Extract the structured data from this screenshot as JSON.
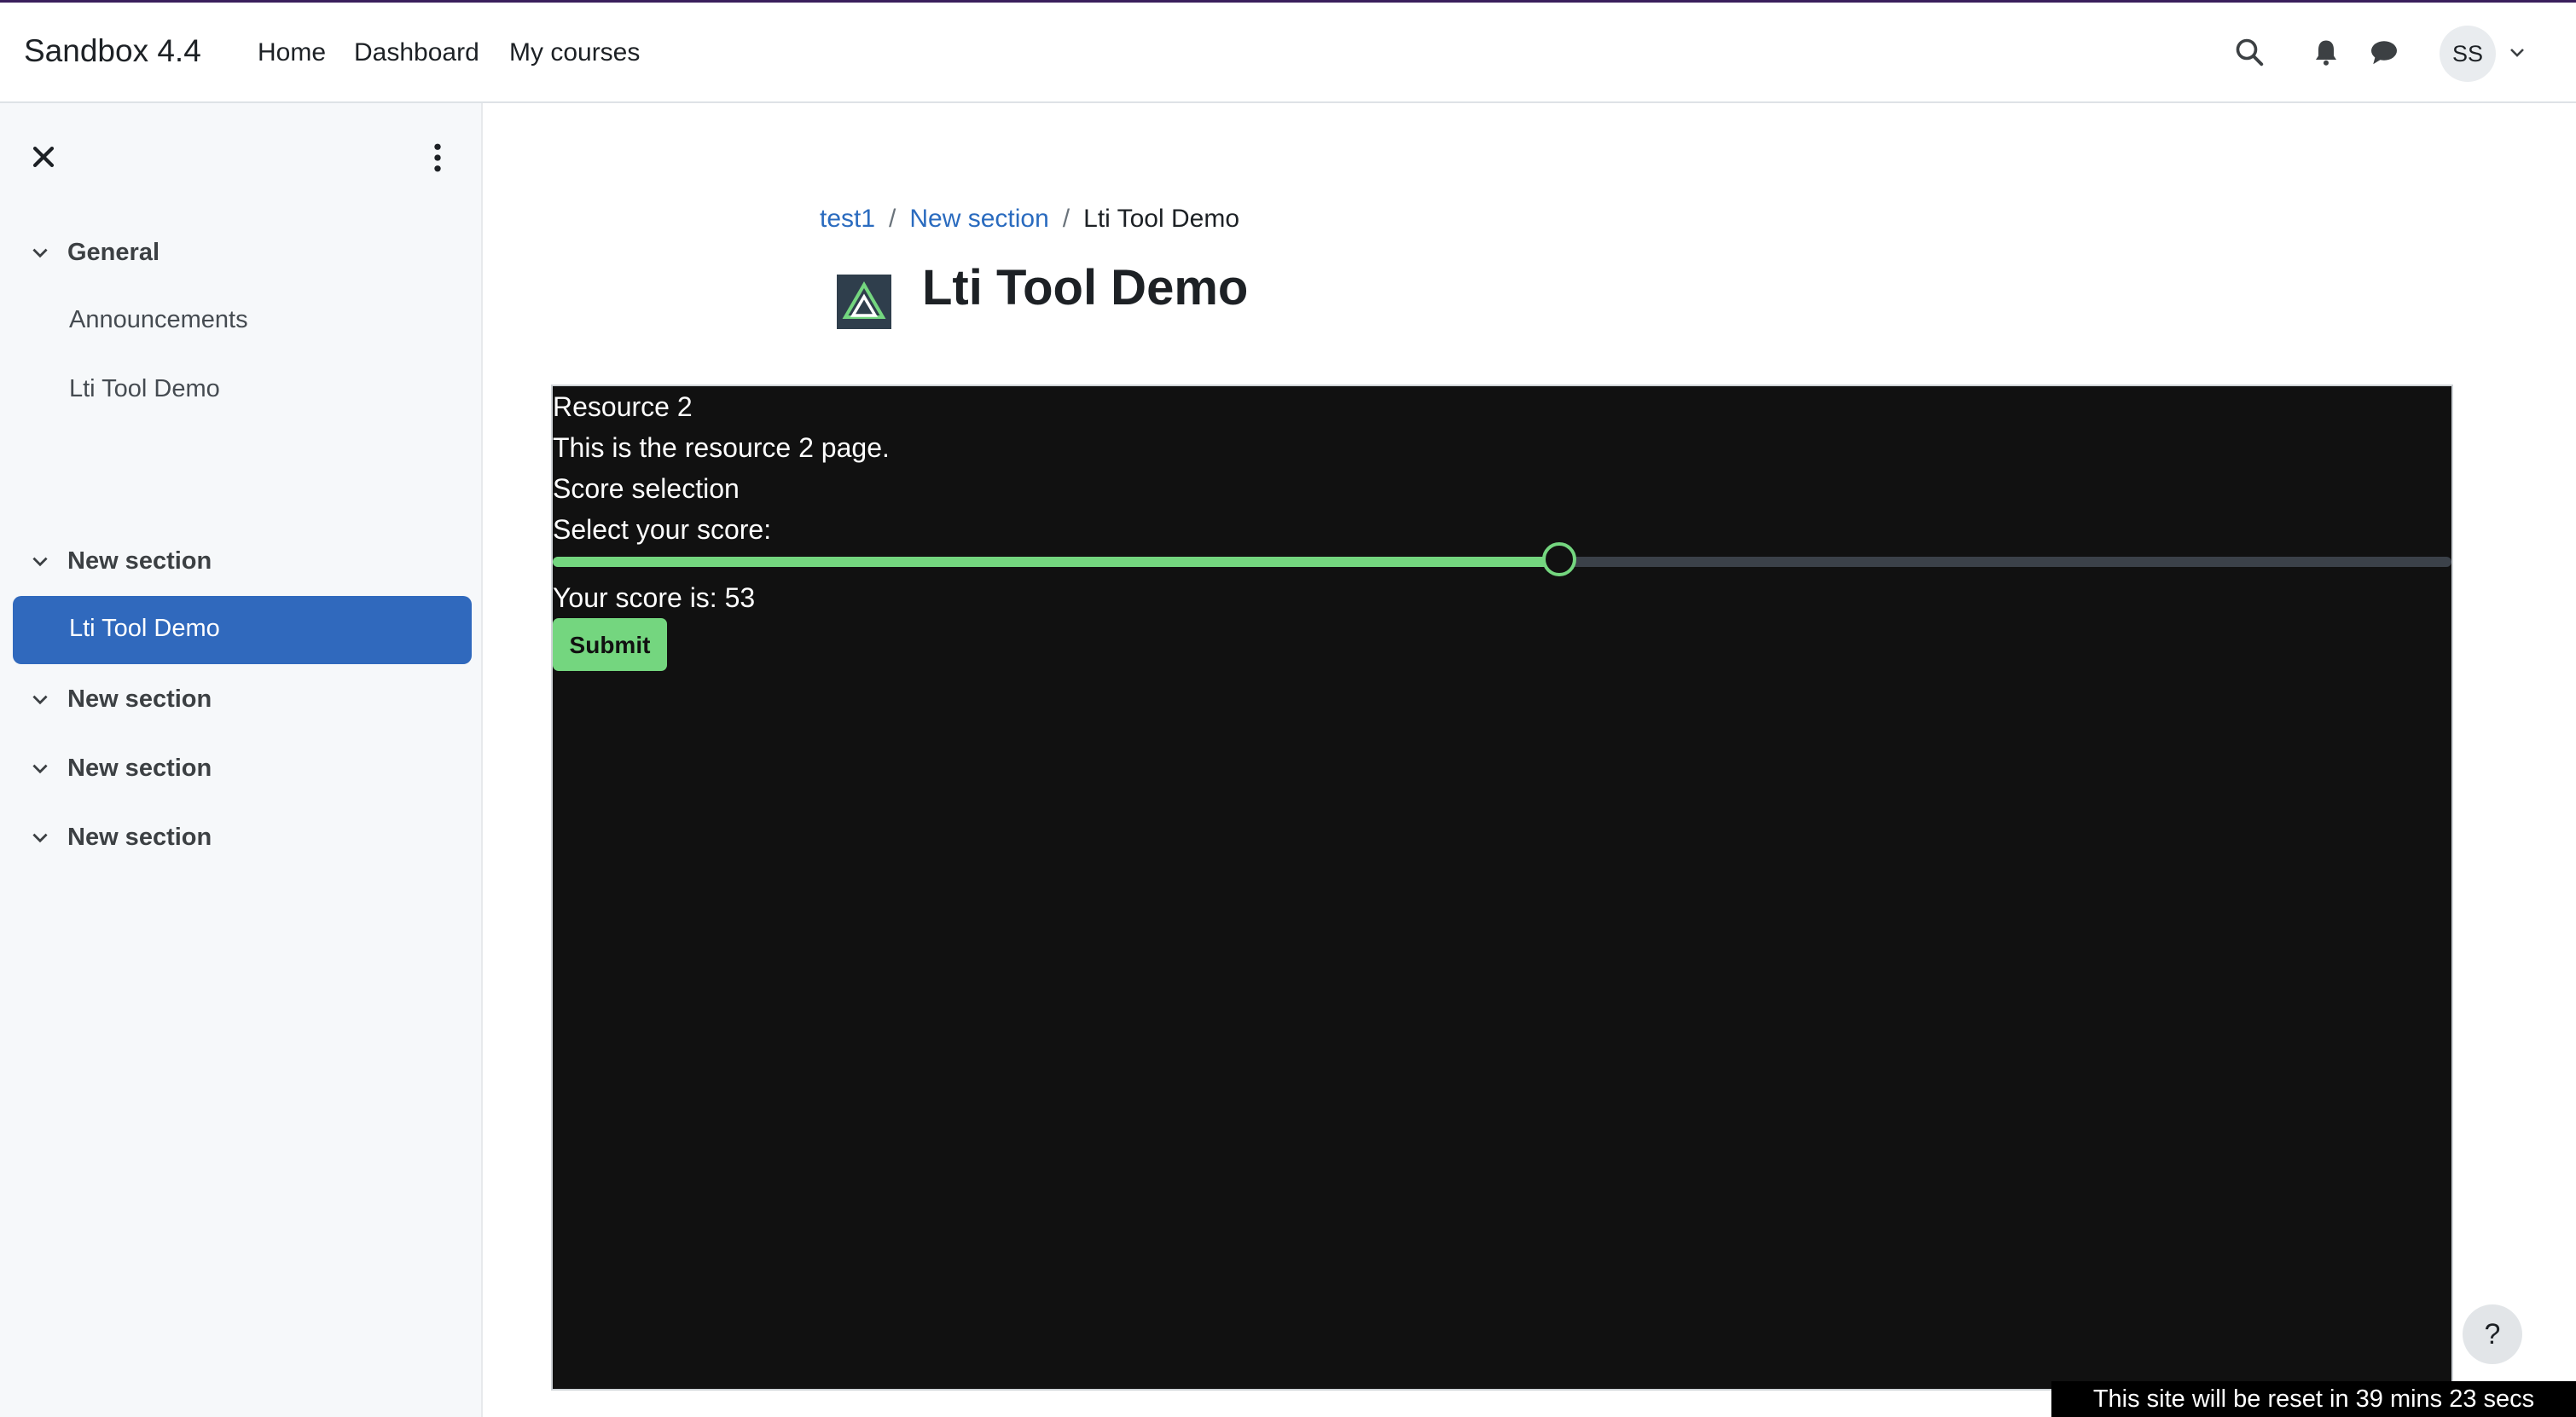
{
  "navbar": {
    "brand": "Sandbox 4.4",
    "links": [
      "Home",
      "Dashboard",
      "My courses"
    ],
    "avatar_initials": "SS",
    "icons": [
      "search-icon",
      "bell-icon",
      "chat-icon",
      "chevron-down-icon"
    ]
  },
  "sidebar": {
    "icons": [
      "close-icon",
      "more-vertical-icon"
    ],
    "sections": [
      {
        "label": "General",
        "items": [
          "Announcements",
          "Lti Tool Demo"
        ]
      },
      {
        "label": "New section",
        "items": [
          "Lti Tool Demo"
        ],
        "active_item": "Lti Tool Demo"
      },
      {
        "label": "New section",
        "items": []
      },
      {
        "label": "New section",
        "items": []
      },
      {
        "label": "New section",
        "items": []
      }
    ]
  },
  "breadcrumb": {
    "items": [
      "test1",
      "New section",
      "Lti Tool Demo"
    ],
    "separator": "/"
  },
  "page": {
    "title": "Lti Tool Demo"
  },
  "lti": {
    "resource_title": "Resource 2",
    "description": "This is the resource 2 page.",
    "score_heading": "Score selection",
    "select_label": "Select your score:",
    "score_text": "Your score is: 53",
    "score_value": 53,
    "score_max": 100,
    "submit_label": "Submit"
  },
  "help": {
    "label": "?"
  },
  "reset_notice": "This site will be reset in 39 mins 23 secs",
  "colors": {
    "accent": "#3069bd",
    "link": "#2a6bbf",
    "slider": "#74d67f",
    "frame_bg": "#111111"
  }
}
